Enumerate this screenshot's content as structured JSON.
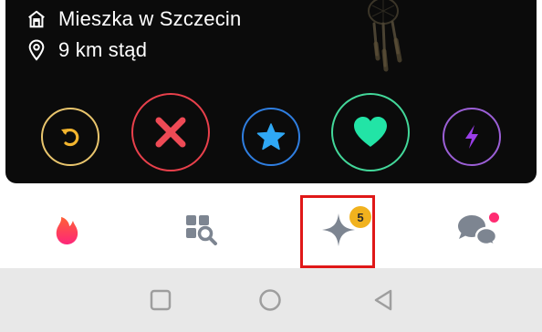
{
  "profile": {
    "lives_in": "Mieszka w Szczecin",
    "distance": "9 km stąd"
  },
  "actions": [
    {
      "name": "rewind",
      "icon": "rewind-icon",
      "color": "#e9c56d"
    },
    {
      "name": "nope",
      "icon": "x-icon",
      "color": "#e8404b"
    },
    {
      "name": "super-like",
      "icon": "star-icon",
      "color": "#2f7ee0"
    },
    {
      "name": "like",
      "icon": "heart-icon",
      "color": "#43d89a"
    },
    {
      "name": "boost",
      "icon": "lightning-icon",
      "color": "#9b5fd6"
    }
  ],
  "nav": {
    "items": [
      {
        "icon": "flame-icon",
        "active": true
      },
      {
        "icon": "explore-grid-icon",
        "active": false
      },
      {
        "icon": "sparkle-icon",
        "active": false,
        "badge": "5"
      },
      {
        "icon": "chat-icon",
        "active": false,
        "notification_dot": true
      }
    ]
  },
  "system_nav": {
    "icons": [
      "recents-square-icon",
      "home-circle-icon",
      "back-triangle-icon"
    ]
  },
  "colors": {
    "highlight_box": "#e01818",
    "badge": "#f1b21e",
    "flame": "#fe4a5a",
    "card_bg": "#0b0b0b"
  }
}
